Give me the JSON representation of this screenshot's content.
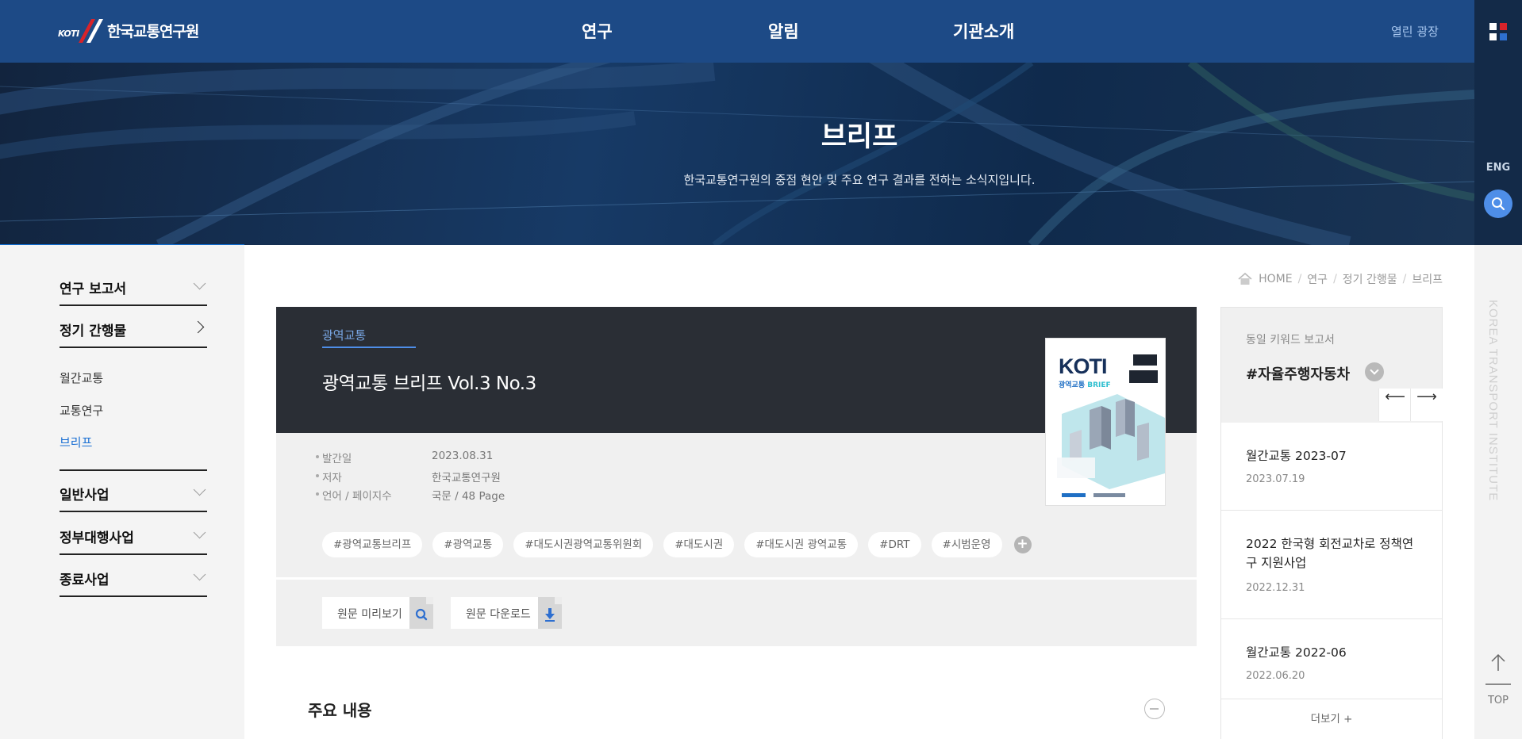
{
  "header": {
    "logo_prefix": "KOTI",
    "logo_name": "한국교통연구원",
    "nav": [
      "연구",
      "알림",
      "기관소개"
    ],
    "open_plaza": "열린 광장"
  },
  "rail": {
    "lang": "ENG",
    "vertical_text": "KOREA TRANSPORT INSTITUTE",
    "top_label": "TOP",
    "grid_colors": [
      "#ffffff",
      "#d8232a",
      "#ffffff",
      "#2e6fd0"
    ]
  },
  "hero": {
    "title": "브리프",
    "subtitle": "한국교통연구원의 중점 현안 및 주요 연구 결과를 전하는 소식지입니다.",
    "section": "연구"
  },
  "sidebar": {
    "items": [
      {
        "label": "연구 보고서"
      },
      {
        "label": "정기 간행물"
      },
      {
        "label": "일반사업"
      },
      {
        "label": "정부대행사업"
      },
      {
        "label": "종료사업"
      }
    ],
    "sub_items": [
      {
        "label": "월간교통"
      },
      {
        "label": "교통연구"
      },
      {
        "label": "브리프"
      }
    ]
  },
  "breadcrumb": [
    "HOME",
    "연구",
    "정기 간행물",
    "브리프"
  ],
  "doc": {
    "category": "광역교통",
    "title": "광역교통 브리프 Vol.3 No.3",
    "meta": [
      {
        "key": "발간일",
        "value": "2023.08.31"
      },
      {
        "key": "저자",
        "value": "한국교통연구원"
      },
      {
        "key": "언어 / 페이지수",
        "value": "국문 / 48 Page"
      }
    ],
    "tags": [
      "#광역교통브리프",
      "#광역교통",
      "#대도시권광역교통위원회",
      "#대도시권",
      "#대도시권 광역교통",
      "#DRT",
      "#시범운영"
    ],
    "preview_label": "원문 미리보기",
    "download_label": "원문 다운로드",
    "cover_brand": "KOTI",
    "cover_sub_a": "광역교통",
    "cover_sub_b": "BRIEF"
  },
  "summary": {
    "title": "주요 내용"
  },
  "related": {
    "label": "동일 키워드 보고서",
    "keyword": "#자율주행자동차",
    "items": [
      {
        "title": "월간교통 2023-07",
        "date": "2023.07.19"
      },
      {
        "title": "2022 한국형 회전교차로 정책연구 지원사업",
        "date": "2022.12.31"
      },
      {
        "title": "월간교통 2022-06",
        "date": "2022.06.20"
      }
    ],
    "more": "더보기  +"
  }
}
